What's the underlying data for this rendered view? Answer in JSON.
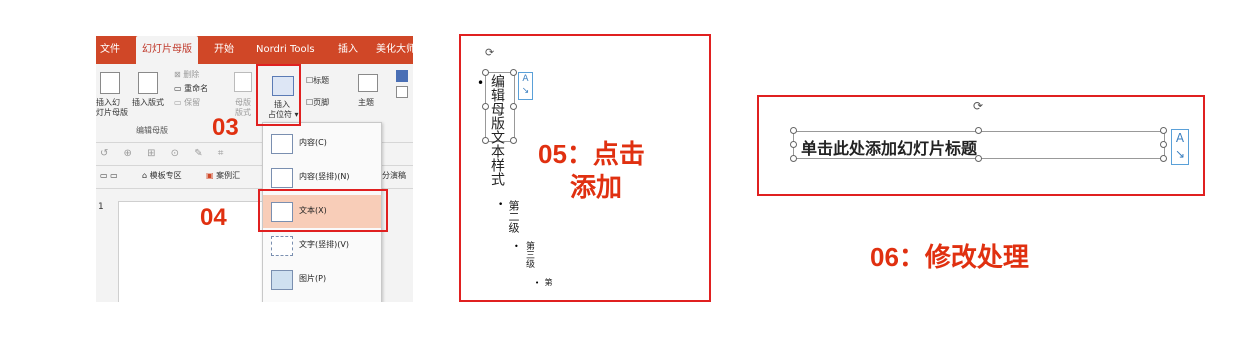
{
  "ribbon": {
    "tabs": [
      "文件",
      "幻灯片母版",
      "开始",
      "Nordri Tools",
      "插入",
      "美化大师"
    ],
    "active_tab_index": 1,
    "insert_slide_master": "插入幻",
    "insert_slide_master2": "灯片母版",
    "insert_layout": "插入版式",
    "delete": "删除",
    "rename": "重命名",
    "preserve": "保留",
    "group_label": "编辑母版",
    "master_layout": "母版",
    "master_layout2": "版式",
    "insert_placeholder": "插入",
    "insert_placeholder2": "占位符",
    "title_check": "标题",
    "footer_check": "页脚",
    "theme": "主题",
    "toolbar2": [
      "模板专区",
      "案例汇",
      "分演稿"
    ],
    "slide_number": "1"
  },
  "dropdown": {
    "items": [
      "内容(C)",
      "内容(竖排)(N)",
      "文本(X)",
      "文字(竖排)(V)",
      "图片(P)"
    ],
    "selected_index": 2
  },
  "steps": {
    "step03": "03",
    "step04": "04",
    "step05_line1": "05：点击",
    "step05_line2": "添加",
    "step06": "06：修改处理"
  },
  "vertical_text": {
    "bullet": "•",
    "level1": "编辑母版文本样式",
    "level2": "第二级",
    "level3": "第三级",
    "level4": "第",
    "autofit_icon_label": "A"
  },
  "title_placeholder": {
    "text": "单击此处添加幻灯片标题",
    "autofit_icon_label": "A"
  },
  "colors": {
    "accent_red": "#e02020",
    "tab_orange": "#d04727",
    "selected_item": "#f8cdb8"
  }
}
